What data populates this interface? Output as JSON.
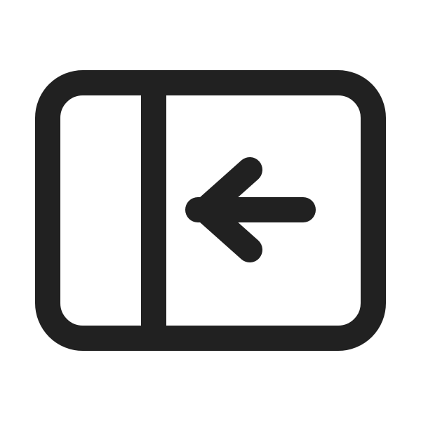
{
  "icon": {
    "name": "panel-left-collapse-icon",
    "stroke_color": "#212121",
    "background_color": "#ffffff"
  }
}
